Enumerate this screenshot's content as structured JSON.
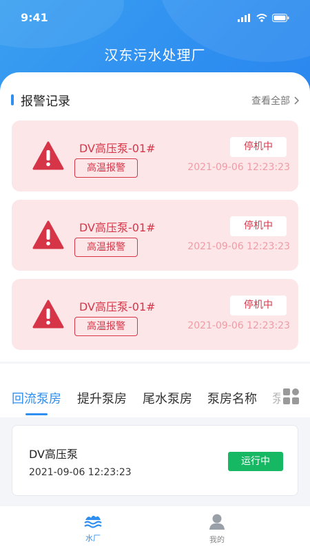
{
  "status": {
    "time": "9:41"
  },
  "header": {
    "title": "汉东污水处理厂"
  },
  "alarms_section": {
    "title": "报警记录",
    "more": "查看全部"
  },
  "alarms": [
    {
      "name": "DV高压泵-01#",
      "tag": "高温报警",
      "status": "停机中",
      "time": "2021-09-06   12:23:23"
    },
    {
      "name": "DV高压泵-01#",
      "tag": "高温报警",
      "status": "停机中",
      "time": "2021-09-06   12:23:23"
    },
    {
      "name": "DV高压泵-01#",
      "tag": "高温报警",
      "status": "停机中",
      "time": "2021-09-06   12:23:23"
    }
  ],
  "tabs": [
    {
      "label": "回流泵房",
      "active": true
    },
    {
      "label": "提升泵房",
      "active": false
    },
    {
      "label": "尾水泵房",
      "active": false
    },
    {
      "label": "泵房名称",
      "active": false
    },
    {
      "label": "泵",
      "active": false
    }
  ],
  "pump": {
    "name": "DV高压泵",
    "time": "2021-09-06   12:23:23",
    "status": "运行中"
  },
  "nav": [
    {
      "label": "水厂",
      "icon": "water-plant-icon",
      "active": true
    },
    {
      "label": "我的",
      "icon": "user-icon",
      "active": false
    }
  ],
  "colors": {
    "accent": "#2f8ff0",
    "alarm": "#d63548",
    "alarm_bg": "#fde6e8",
    "running": "#16b864"
  }
}
